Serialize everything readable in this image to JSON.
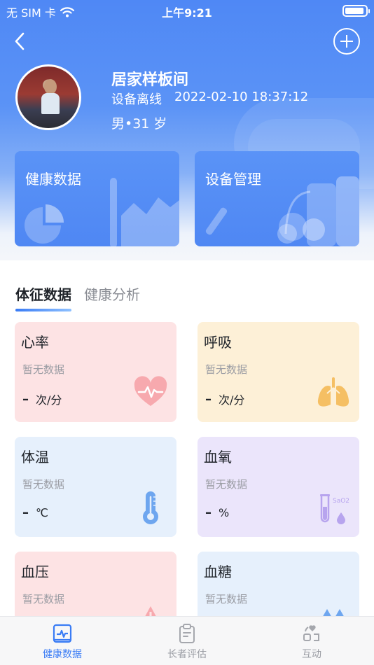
{
  "status_bar": {
    "carrier": "无 SIM 卡",
    "time": "上午9:21"
  },
  "profile": {
    "name": "居家样板间",
    "status": "设备离线",
    "datetime": "2022-02-10 18:37:12",
    "gender_age": "男•31 岁"
  },
  "cards": {
    "health_data": "健康数据",
    "device_manage": "设备管理"
  },
  "tabs": [
    {
      "label": "体征数据",
      "active": true
    },
    {
      "label": "健康分析",
      "active": false
    }
  ],
  "vitals": [
    {
      "title": "心率",
      "nodata": "暂无数据",
      "dash": "–",
      "unit": "次/分",
      "icon": "heart-pulse-icon",
      "bg": "#fde3e4",
      "accent": "#f7b0b4"
    },
    {
      "title": "呼吸",
      "nodata": "暂无数据",
      "dash": "–",
      "unit": "次/分",
      "icon": "lungs-icon",
      "bg": "#fdf0d7",
      "accent": "#f7c56e"
    },
    {
      "title": "体温",
      "nodata": "暂无数据",
      "dash": "–",
      "unit": "℃",
      "icon": "thermometer-icon",
      "bg": "#e6f0fc",
      "accent": "#6ea6ef"
    },
    {
      "title": "血氧",
      "nodata": "暂无数据",
      "dash": "–",
      "unit": "%",
      "icon": "test-tube-icon",
      "icon_text": "SaO2",
      "bg": "#ebe5fb",
      "accent": "#b7a4ee"
    },
    {
      "title": "血压",
      "nodata": "暂无数据",
      "icon": "warning-icon",
      "bg": "#fde3e4",
      "accent": "#f7b0b4"
    },
    {
      "title": "血糖",
      "nodata": "暂无数据",
      "icon": "drops-icon",
      "bg": "#e6f0fc",
      "accent": "#6ea6ef"
    }
  ],
  "bottom_nav": [
    {
      "label": "健康数据",
      "icon": "health-chart-icon",
      "active": true
    },
    {
      "label": "长者评估",
      "icon": "clipboard-icon",
      "active": false
    },
    {
      "label": "互动",
      "icon": "interaction-icon",
      "active": false
    }
  ],
  "colors": {
    "primary": "#3a7cf5",
    "header_blue": "#4f88f5"
  }
}
